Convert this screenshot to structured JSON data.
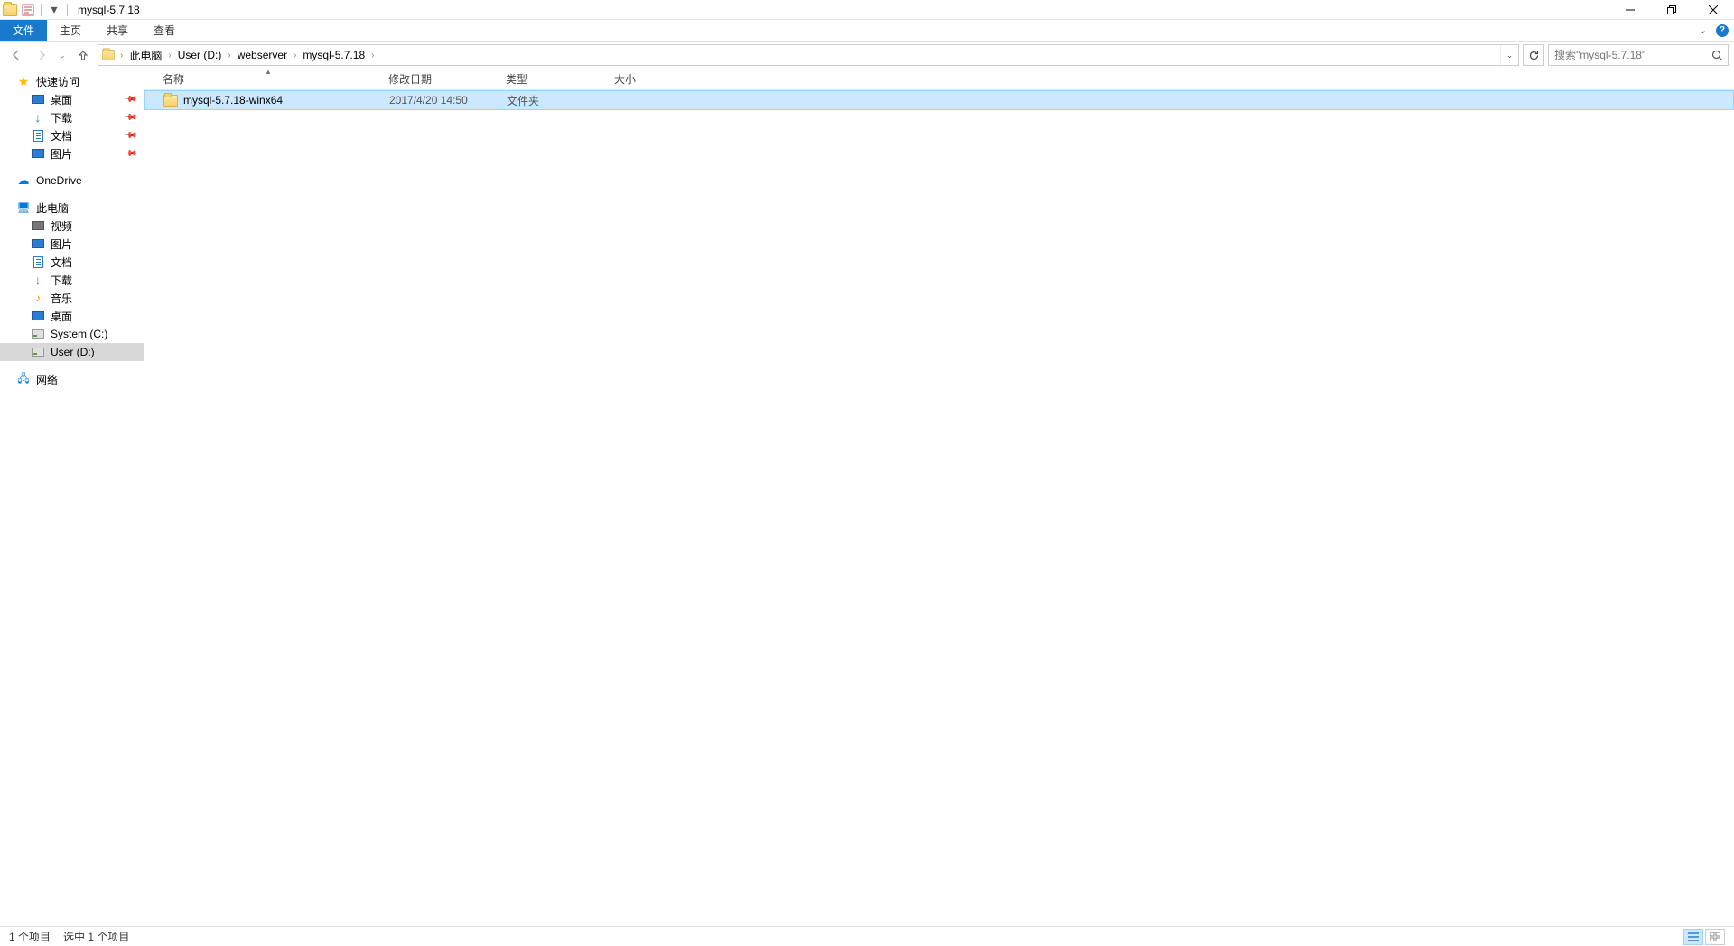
{
  "window": {
    "title": "mysql-5.7.18"
  },
  "ribbon": {
    "file": "文件",
    "home": "主页",
    "share": "共享",
    "view": "查看"
  },
  "breadcrumb": {
    "items": [
      "此电脑",
      "User (D:)",
      "webserver",
      "mysql-5.7.18"
    ]
  },
  "search": {
    "placeholder": "搜索\"mysql-5.7.18\""
  },
  "sidebar": {
    "quick_access": "快速访问",
    "quick_items": [
      {
        "label": "桌面",
        "icon": "desktop"
      },
      {
        "label": "下载",
        "icon": "download"
      },
      {
        "label": "文档",
        "icon": "document"
      },
      {
        "label": "图片",
        "icon": "picture"
      }
    ],
    "onedrive": "OneDrive",
    "this_pc": "此电脑",
    "pc_items": [
      {
        "label": "视频",
        "icon": "video"
      },
      {
        "label": "图片",
        "icon": "picture"
      },
      {
        "label": "文档",
        "icon": "document"
      },
      {
        "label": "下载",
        "icon": "download"
      },
      {
        "label": "音乐",
        "icon": "music"
      },
      {
        "label": "桌面",
        "icon": "desktop"
      },
      {
        "label": "System (C:)",
        "icon": "drive"
      },
      {
        "label": "User (D:)",
        "icon": "drive",
        "selected": true
      }
    ],
    "network": "网络"
  },
  "columns": {
    "name": "名称",
    "modified": "修改日期",
    "type": "类型",
    "size": "大小"
  },
  "rows": [
    {
      "name": "mysql-5.7.18-winx64",
      "modified": "2017/4/20 14:50",
      "type": "文件夹",
      "size": "",
      "selected": true
    }
  ],
  "status": {
    "left1": "1 个项目",
    "left2": "选中 1 个项目"
  }
}
